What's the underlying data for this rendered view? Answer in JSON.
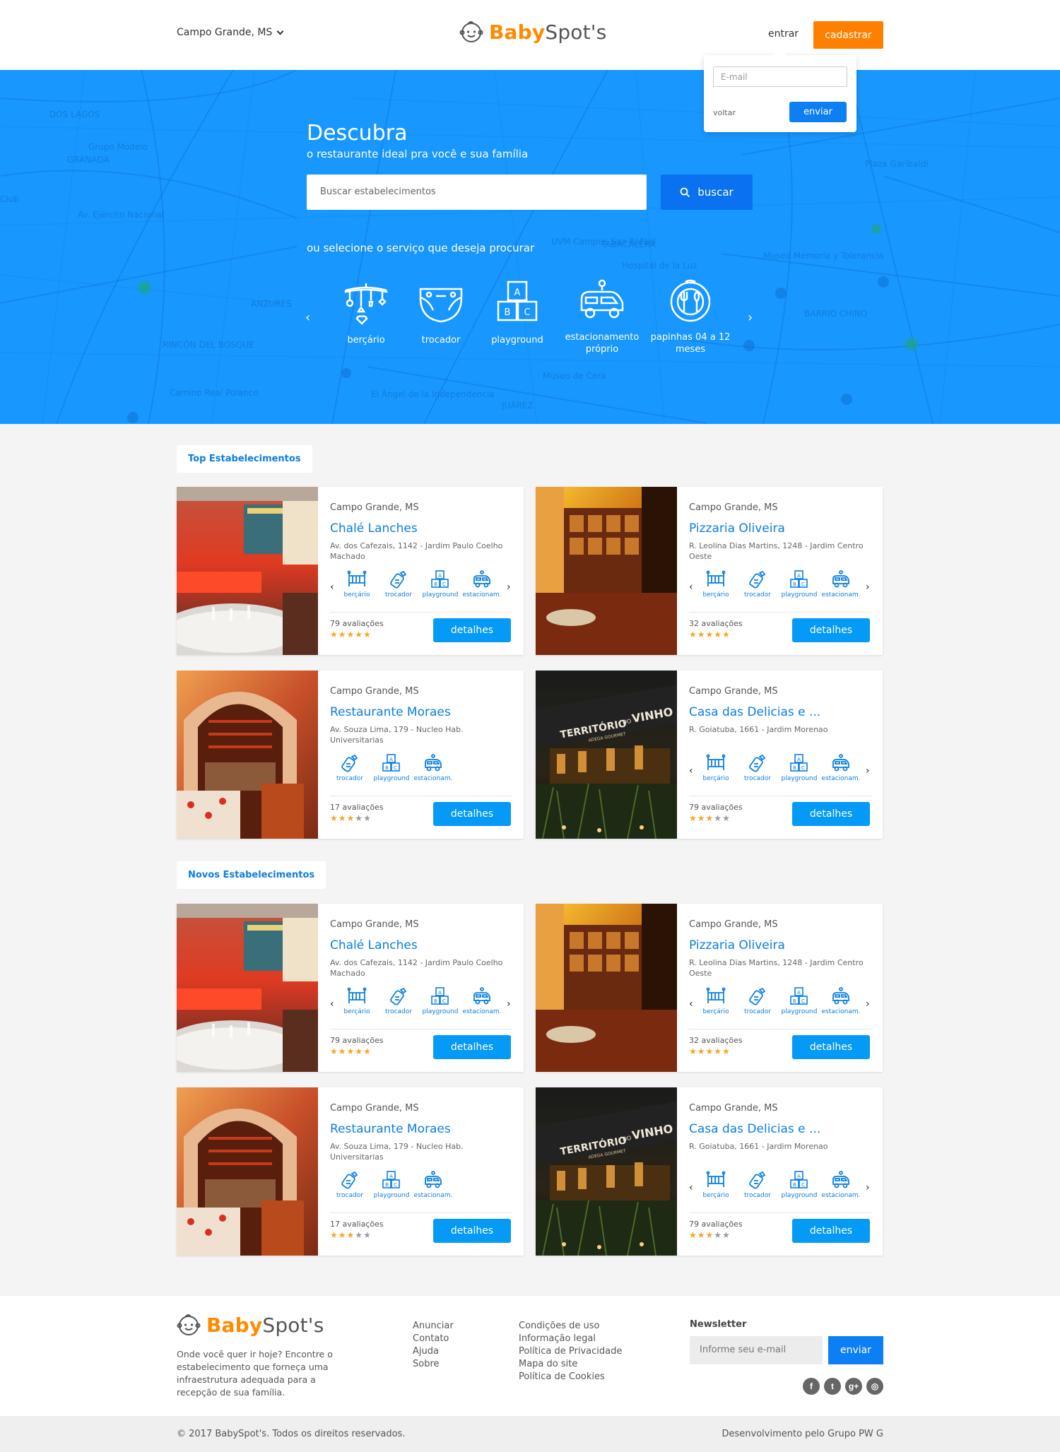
{
  "header": {
    "city": "Campo Grande, MS",
    "logo_bold": "Baby",
    "logo_rest": "Spot's",
    "login": "entrar",
    "signup": "cadastrar"
  },
  "login_popover": {
    "email_placeholder": "E-mail",
    "back": "voltar",
    "send": "enviar"
  },
  "hero": {
    "title": "Descubra",
    "subtitle": "o restaurante ideal pra você e sua família",
    "search_placeholder": "Buscar estabelecimentos",
    "search_button": "buscar",
    "services_label": "ou selecione o serviço que deseja procurar",
    "services": [
      {
        "icon": "crib-mobile-icon",
        "label": "berçário"
      },
      {
        "icon": "diaper-icon",
        "label": "trocador"
      },
      {
        "icon": "toy-blocks-icon",
        "label": "playground"
      },
      {
        "icon": "stroller-car-icon",
        "label": "estacionamento próprio"
      },
      {
        "icon": "baby-plate-icon",
        "label": "papinhas 04 a 12 meses"
      }
    ],
    "map_labels": [
      "DOS LAGOS",
      "GRANADA",
      "Grupo Modelo",
      "Av. Ejército Nacional",
      "ANZURES",
      "RINCÓN DEL BOSQUE",
      "TABACALERA",
      "Hospital de la Luz",
      "UVM Campus San Rafael",
      "Museo de Cera",
      "JUÁREZ",
      "El Ángel de la Independencia",
      "Museo Memoria y Tolerancia",
      "BARRIO CHINO",
      "Plaza Garibaldi",
      "Camino Real Polanco",
      "Club"
    ]
  },
  "sections": [
    {
      "label": "Top Estabelecimentos"
    },
    {
      "label": "Novos Estabelecimentos"
    }
  ],
  "cards": [
    {
      "city": "Campo  Grande, MS",
      "name": "Chalé Lanches",
      "address": "Av. dos Cafezais, 1142 - Jardim Paulo Coelho Machado",
      "reviews": "79 avaliações",
      "rating": 5,
      "amenities": [
        "berçário",
        "trocador",
        "playground",
        "estacionam."
      ],
      "details": "detalhes"
    },
    {
      "city": "Campo  Grande, MS",
      "name": "Pizzaria Oliveira",
      "address": "R. Leolina Dias Martins, 1248 - Jardim Centro Oeste",
      "reviews": "32 avaliações",
      "rating": 4.5,
      "amenities": [
        "berçário",
        "trocador",
        "playground",
        "estacionam."
      ],
      "details": "detalhes"
    },
    {
      "city": "Campo  Grande, MS",
      "name": "Restaurante Moraes",
      "address": "Av. Souza Lima, 179 - Nucleo Hab. Universitarias",
      "reviews": "17 avaliações",
      "rating": 3,
      "amenities": [
        "trocador",
        "playground",
        "estacionam."
      ],
      "details": "detalhes"
    },
    {
      "city": "Campo  Grande, MS",
      "name": "Casa das Delicias e ...",
      "address": "R. Goiatuba, 1661 - Jardim Morenao",
      "reviews": "79 avaliações",
      "rating": 3,
      "amenities": [
        "berçário",
        "trocador",
        "playground",
        "estacionam."
      ],
      "details": "detalhes"
    },
    {
      "city": "Campo  Grande, MS",
      "name": "Chalé Lanches",
      "address": "Av. dos Cafezais, 1142 - Jardim Paulo Coelho Machado",
      "reviews": "79 avaliações",
      "rating": 5,
      "amenities": [
        "berçário",
        "trocador",
        "playground",
        "estacionam."
      ],
      "details": "detalhes"
    },
    {
      "city": "Campo  Grande, MS",
      "name": "Pizzaria Oliveira",
      "address": "R. Leolina Dias Martins, 1248 - Jardim Centro Oeste",
      "reviews": "32 avaliações",
      "rating": 4.5,
      "amenities": [
        "berçário",
        "trocador",
        "playground",
        "estacionam."
      ],
      "details": "detalhes"
    },
    {
      "city": "Campo  Grande, MS",
      "name": "Restaurante Moraes",
      "address": "Av. Souza Lima, 179 - Nucleo Hab. Universitarias",
      "reviews": "17 avaliações",
      "rating": 3,
      "amenities": [
        "trocador",
        "playground",
        "estacionam."
      ],
      "details": "detalhes"
    },
    {
      "city": "Campo  Grande, MS",
      "name": "Casa das Delicias e ...",
      "address": "R. Goiatuba, 1661 - Jardim Morenao",
      "reviews": "79 avaliações",
      "rating": 3,
      "amenities": [
        "berçário",
        "trocador",
        "playground",
        "estacionam."
      ],
      "details": "detalhes"
    }
  ],
  "photo_signage": {
    "wine_sign": "TERRITÓRIO",
    "wine_sign_small": "DO",
    "wine_sign_big": "VINHO",
    "wine_sub": "ADEGA GOURMET"
  },
  "footer": {
    "logo_bold": "Baby",
    "logo_rest": "Spot's",
    "about": "Onde você quer ir hoje? Encontre o estabelecimento que forneça uma infraestrutura adequada para a recepção de sua família.",
    "links_col1": [
      "Anunciar",
      "Contato",
      "Ajuda",
      "Sobre"
    ],
    "links_col2": [
      "Condições de uso",
      "Informação legal",
      "Política de Privacidade",
      "Mapa do site",
      "Política de Cookies"
    ],
    "newsletter_title": "Newsletter",
    "newsletter_placeholder": "Informe seu e-mail",
    "newsletter_button": "enviar",
    "socials": [
      {
        "icon": "facebook-icon",
        "glyph": "f"
      },
      {
        "icon": "twitter-icon",
        "glyph": "t"
      },
      {
        "icon": "google-plus-icon",
        "glyph": "g+"
      },
      {
        "icon": "instagram-icon",
        "glyph": "◎"
      }
    ],
    "copyright": "© 2017 BabySpot's. Todos os direitos reservados.",
    "developer": "Desenvolvimento pelo Grupo  PW  G"
  },
  "colors": {
    "primary_blue": "#1897fe",
    "accent_orange": "#ff8000",
    "link_blue": "#0a7fe0",
    "button_blue": "#049af5"
  }
}
